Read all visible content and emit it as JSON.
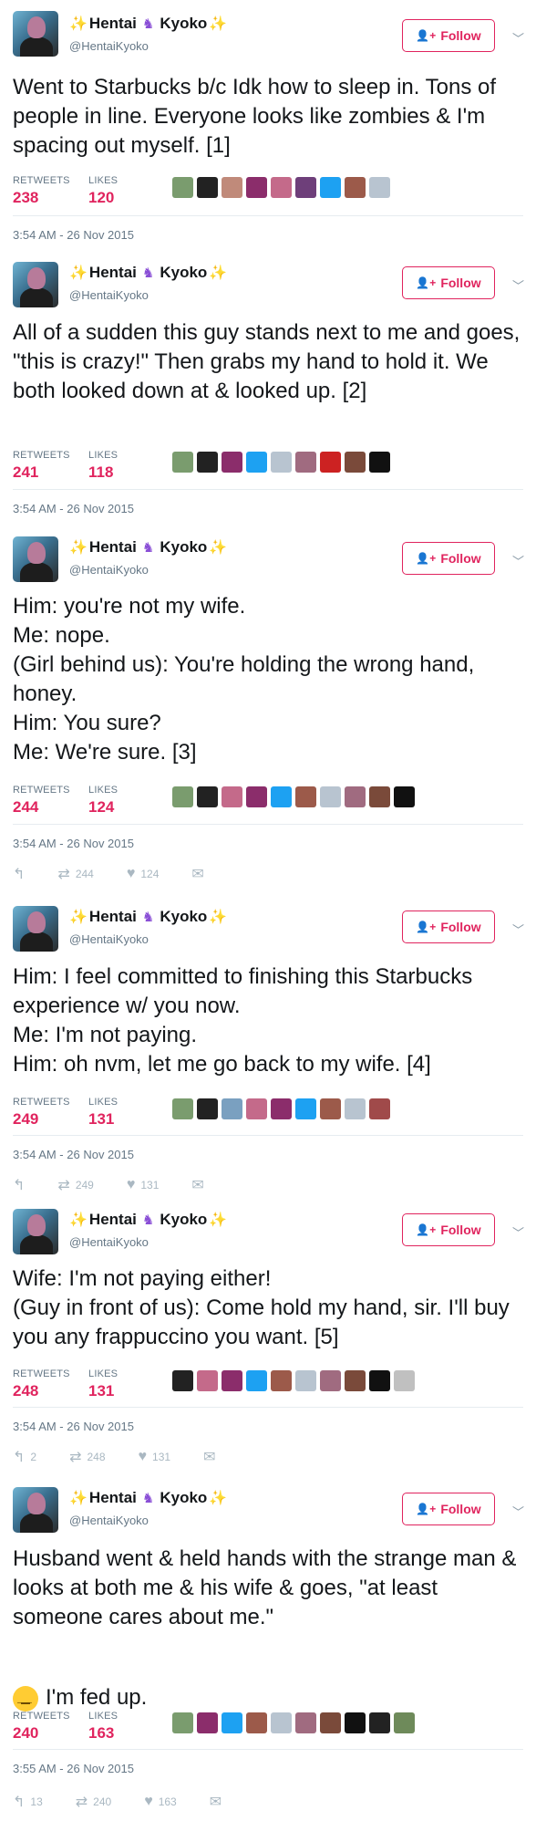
{
  "user": {
    "name_first": "Hentai",
    "name_last": "Kyoko",
    "handle": "@HentaiKyoko",
    "follow_label": "Follow"
  },
  "colors": {
    "accent": "#e0245e",
    "muted": "#657786",
    "divider": "#e6ecf0"
  },
  "stat_labels": {
    "retweets": "RETWEETS",
    "likes": "LIKES"
  },
  "tweets": [
    {
      "text": "Went to Starbucks b/c Idk how to sleep in. Tons of people in line. Everyone looks like zombies & I'm spacing out myself. [1]",
      "retweets": "238",
      "likes": "120",
      "time": "3:54 AM - 26 Nov 2015",
      "liker_colors": [
        "#7a9c6e",
        "#222222",
        "#c08a7a",
        "#8b2d6b",
        "#c46a8a",
        "#6e3f7a",
        "#1da1f2",
        "#9c5a4a",
        "#b8c4d0"
      ]
    },
    {
      "text": "All of a sudden this guy stands next to me and goes, \"this is crazy!\" Then grabs my hand to hold it. We both looked down at & looked up. [2]",
      "retweets": "241",
      "likes": "118",
      "time": "3:54 AM - 26 Nov 2015",
      "liker_colors": [
        "#7a9c6e",
        "#222222",
        "#8b2d6b",
        "#1da1f2",
        "#b8c4d0",
        "#a06b80",
        "#cc2222",
        "#7a4a3a",
        "#111111"
      ]
    },
    {
      "text": "Him: you're not my wife.\nMe: nope.\n(Girl behind us): You're holding the wrong hand, honey.\nHim: You sure?\nMe: We're sure. [3]",
      "retweets": "244",
      "likes": "124",
      "time": "3:54 AM - 26 Nov 2015",
      "actions": {
        "retweets": "244",
        "likes": "124"
      },
      "liker_colors": [
        "#7a9c6e",
        "#222222",
        "#c46a8a",
        "#8b2d6b",
        "#1da1f2",
        "#9c5a4a",
        "#b8c4d0",
        "#a06b80",
        "#7a4a3a",
        "#111111"
      ]
    },
    {
      "text": "Him: I feel committed to finishing this Starbucks experience w/ you now.\nMe: I'm not paying.\nHim: oh nvm, let me go back to my wife. [4]",
      "retweets": "249",
      "likes": "131",
      "time": "3:54 AM - 26 Nov 2015",
      "actions": {
        "retweets": "249",
        "likes": "131"
      },
      "liker_colors": [
        "#7a9c6e",
        "#222222",
        "#7aa0c0",
        "#c46a8a",
        "#8b2d6b",
        "#1da1f2",
        "#9c5a4a",
        "#b8c4d0",
        "#a04a4a"
      ]
    },
    {
      "text": "Wife: I'm not paying either!\n(Guy in front of us): Come hold my hand, sir. I'll buy you any frappuccino you want. [5]",
      "retweets": "248",
      "likes": "131",
      "time": "3:54 AM - 26 Nov 2015",
      "actions": {
        "replies": "2",
        "retweets": "248",
        "likes": "131"
      },
      "liker_colors": [
        "#222222",
        "#c46a8a",
        "#8b2d6b",
        "#1da1f2",
        "#9c5a4a",
        "#b8c4d0",
        "#a06b80",
        "#7a4a3a",
        "#111111",
        "#c0c0c0"
      ]
    },
    {
      "text": "Husband went & held hands with the strange man & looks at both me & his wife & goes, \"at least someone cares about me.\"",
      "text2": "I'm fed up.",
      "retweets": "240",
      "likes": "163",
      "time": "3:55 AM - 26 Nov 2015",
      "actions": {
        "replies": "13",
        "retweets": "240",
        "likes": "163"
      },
      "liker_colors": [
        "#7a9c6e",
        "#8b2d6b",
        "#1da1f2",
        "#9c5a4a",
        "#b8c4d0",
        "#a06b80",
        "#7a4a3a",
        "#111111",
        "#222222",
        "#6e8a5a"
      ]
    }
  ]
}
